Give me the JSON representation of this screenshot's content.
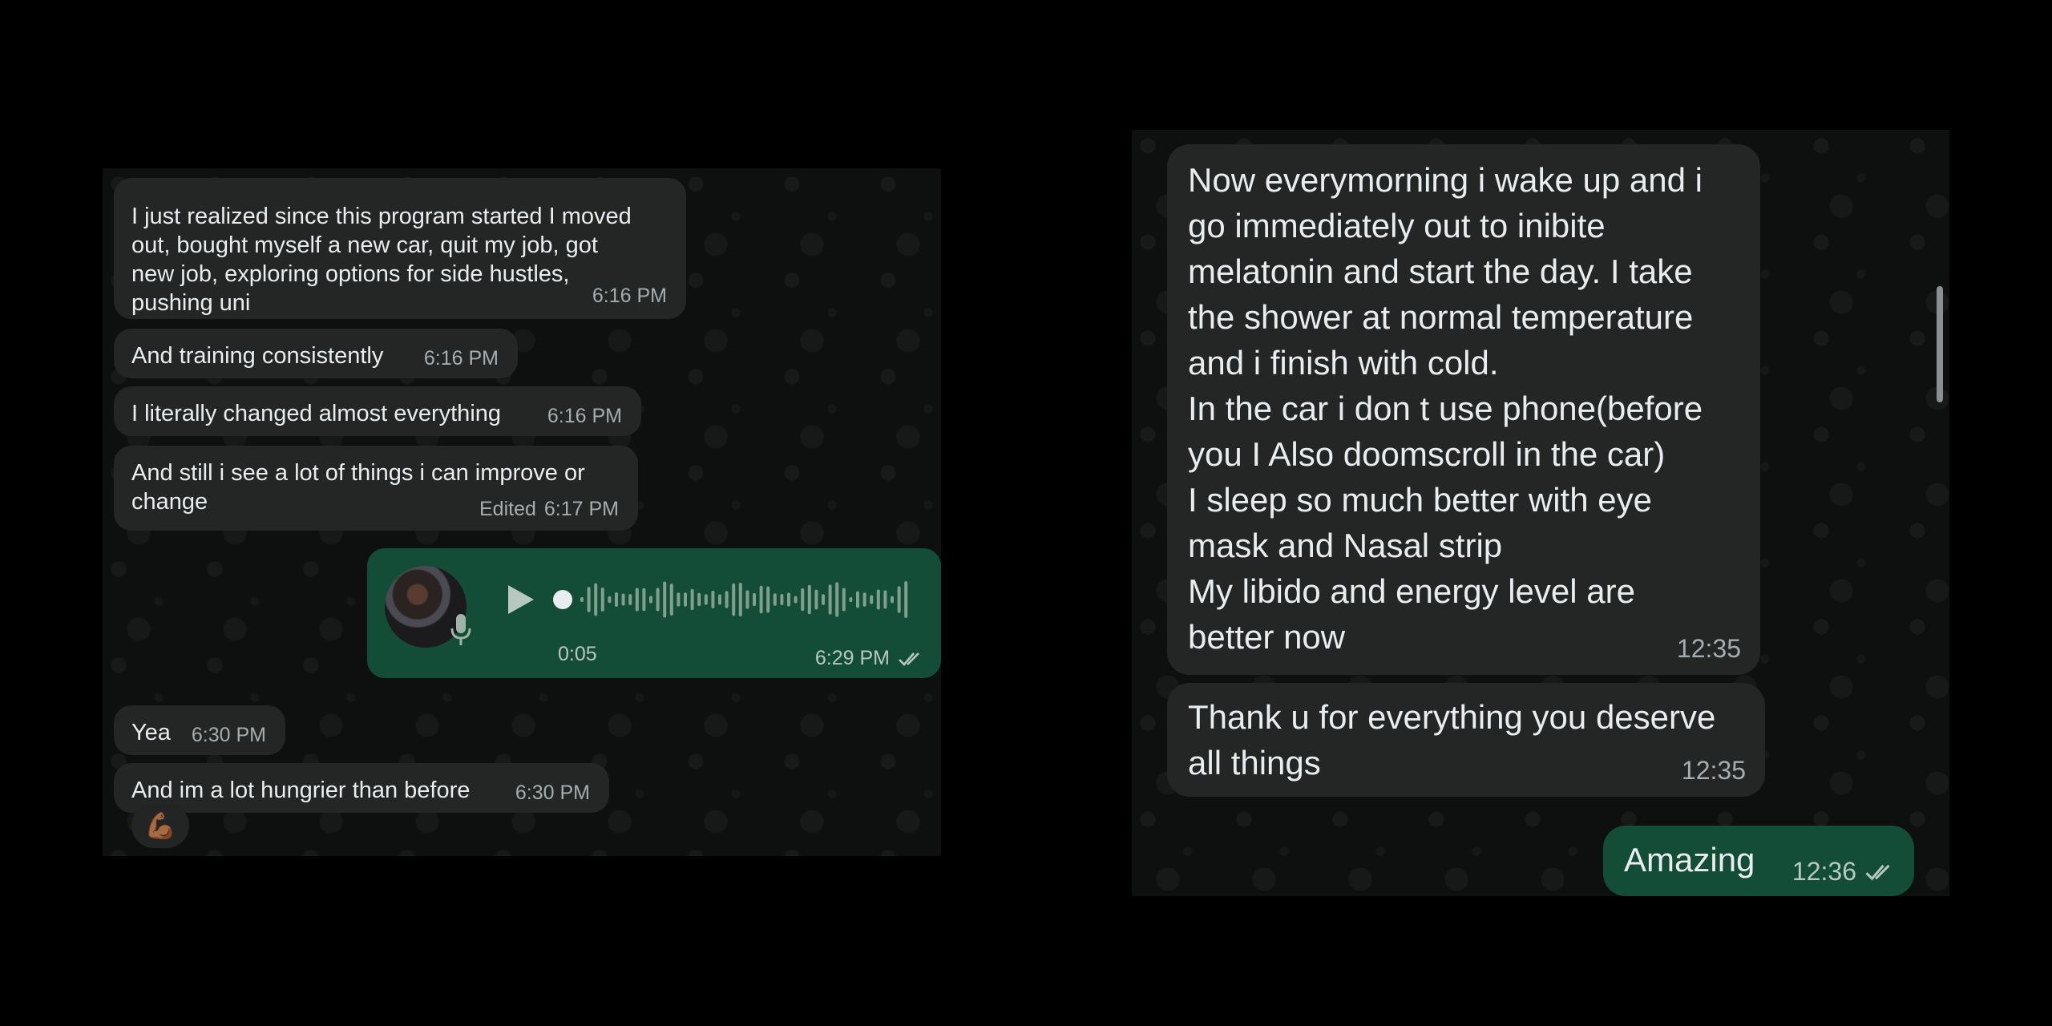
{
  "left_chat": {
    "messages": [
      {
        "text": "I just realized since this program started I moved\nout, bought myself a new car, quit my job, got\nnew job, exploring options for side hustles,\npushing uni",
        "time": "6:16 PM"
      },
      {
        "text": "And training consistently",
        "time": "6:16 PM"
      },
      {
        "text": "I literally changed almost everything",
        "time": "6:16 PM"
      },
      {
        "text": "And still i see a lot of things i can improve or\nchange",
        "edited": "Edited",
        "time": "6:17 PM"
      },
      {
        "text": "Yea",
        "time": "6:30 PM"
      },
      {
        "text": "And im a lot hungrier than before",
        "time": "6:30 PM"
      }
    ],
    "voice": {
      "duration": "0:05",
      "time": "6:29 PM",
      "status": "read"
    },
    "reaction": "💪🏾"
  },
  "right_chat": {
    "messages": [
      {
        "text": "Now everymorning i wake up and i\ngo immediately out to inibite\nmelatonin and start the day. I take\nthe shower at normal temperature\nand i finish with cold.\nIn the car i don t use phone(before\nyou I Also doomscroll in the car)\nI sleep so much better with eye\nmask and Nasal strip\nMy libido and energy level are\nbetter now",
        "time": "12:35"
      },
      {
        "text": "Thank u for everything you deserve\nall things",
        "time": "12:35"
      }
    ],
    "outgoing": {
      "text": "Amazing",
      "time": "12:36",
      "status": "read"
    }
  },
  "colors": {
    "incoming_bubble": "#242626",
    "outgoing_bubble": "#144d37",
    "chat_background": "#0e0f0f",
    "text": "#e9edef",
    "meta": "#a6adb0"
  }
}
